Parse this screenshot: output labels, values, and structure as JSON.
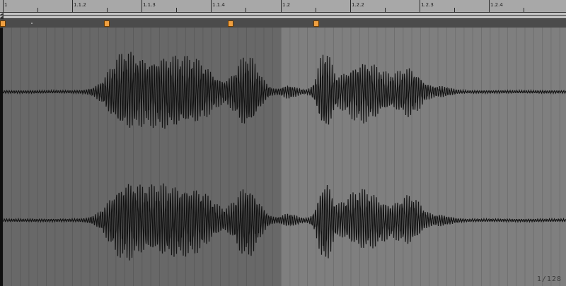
{
  "colors": {
    "ruler_bg": "#a8a8a8",
    "waveform": "#121212",
    "region_dark": "#686868",
    "region_light": "#7f7f7f",
    "warp_marker": "#f0a040",
    "marker_lane": "#4b4b4b"
  },
  "ruler": {
    "labels": [
      "1",
      "1.1.2",
      "1.1.3",
      "1.1.4",
      "1.2",
      "1.2.2",
      "1.2.3",
      "1.2.4"
    ]
  },
  "loop_brace": {
    "start_icon": "loop-start-arrow-icon",
    "end_icon": "loop-end-arrow-icon"
  },
  "warp_markers": {
    "icon": "warp-marker-icon",
    "count": 4
  },
  "waveform": {
    "channels": [
      "left",
      "right"
    ]
  },
  "status": {
    "zoom_label": "1/128"
  }
}
